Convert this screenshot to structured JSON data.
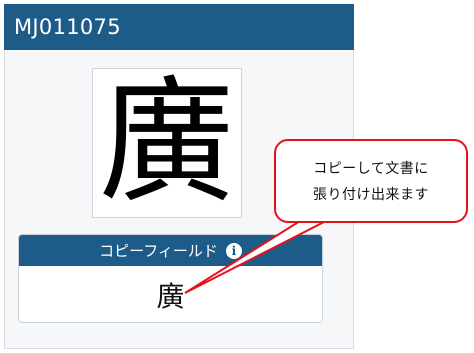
{
  "card": {
    "header_title": "MJ011075"
  },
  "glyph_panel": {
    "glyph": "廣"
  },
  "copy_field": {
    "header_label": "コピーフィールド",
    "info_icon": "info-circle-icon",
    "value": "廣"
  },
  "callout": {
    "line1": "コピーして文書に",
    "line2": "張り付け出来ます"
  },
  "colors": {
    "header_bg": "#1d5c88",
    "callout_border": "#e3121b"
  }
}
